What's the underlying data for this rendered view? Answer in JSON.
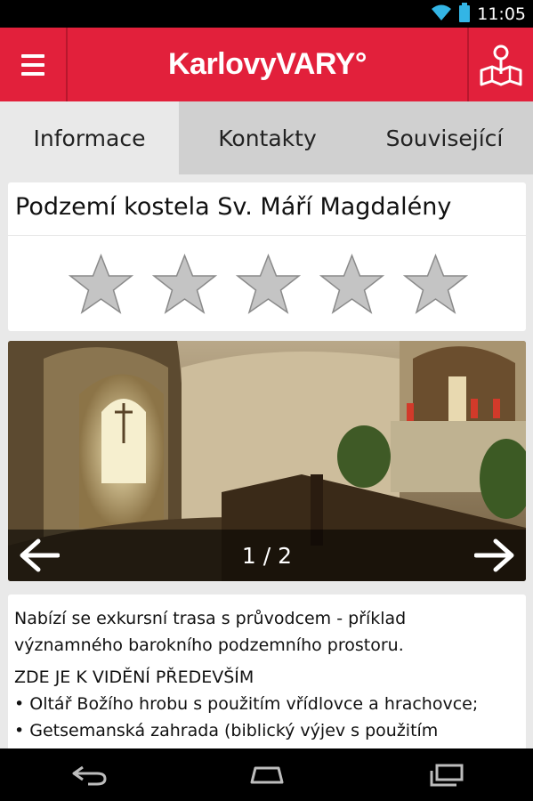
{
  "status_bar": {
    "time": "11:05",
    "icons": [
      "wifi-icon",
      "battery-icon"
    ]
  },
  "app_bar": {
    "title": "KarlovyVARY°",
    "menu_icon": "hamburger-menu-icon",
    "map_icon": "map-pin-icon",
    "color": "#e2203b"
  },
  "tabs": [
    {
      "label": "Informace",
      "active": true
    },
    {
      "label": "Kontakty",
      "active": false
    },
    {
      "label": "Související",
      "active": false
    }
  ],
  "place": {
    "title": "Podzemí kostela Sv. Máří Magdalény",
    "rating": 0,
    "rating_max": 5
  },
  "gallery": {
    "counter": "1 / 2",
    "prev_icon": "arrow-left-icon",
    "next_icon": "arrow-right-icon"
  },
  "description": {
    "intro": "Nabízí se exkursní trasa s průvodcem - příklad významného barokního podzemního prostoru.",
    "heading": "ZDE JE K VIDĚNÍ PŘEDEVŠÍM",
    "items": [
      "• Oltář Božího hrobu s použitím vřídlovce a hrachovce;",
      "• Getsemanská zahrada (biblický výjev s použitím"
    ]
  },
  "nav_bar": {
    "icons": [
      "back-icon",
      "home-icon",
      "recent-apps-icon"
    ]
  }
}
